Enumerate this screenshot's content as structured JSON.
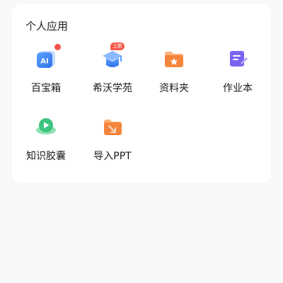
{
  "section": {
    "title": "个人应用"
  },
  "apps": [
    {
      "label": "百宝箱",
      "icon": "ai-toolbox-icon",
      "icon_text": "AI",
      "has_dot": true
    },
    {
      "label": "希沃学苑",
      "icon": "graduation-cap-icon",
      "badge": "上新"
    },
    {
      "label": "资料夹",
      "icon": "folder-star-icon"
    },
    {
      "label": "作业本",
      "icon": "homework-notebook-icon"
    },
    {
      "label": "知识胶囊",
      "icon": "knowledge-capsule-icon"
    },
    {
      "label": "导入PPT",
      "icon": "import-ppt-icon"
    }
  ],
  "colors": {
    "page_bg": "#f7f8fa",
    "card_bg": "#ffffff",
    "red_dot": "#f0544a",
    "blue": "#3a7bf0",
    "orange": "#f5843d",
    "purple": "#7b62f0",
    "green": "#3dc47e"
  }
}
